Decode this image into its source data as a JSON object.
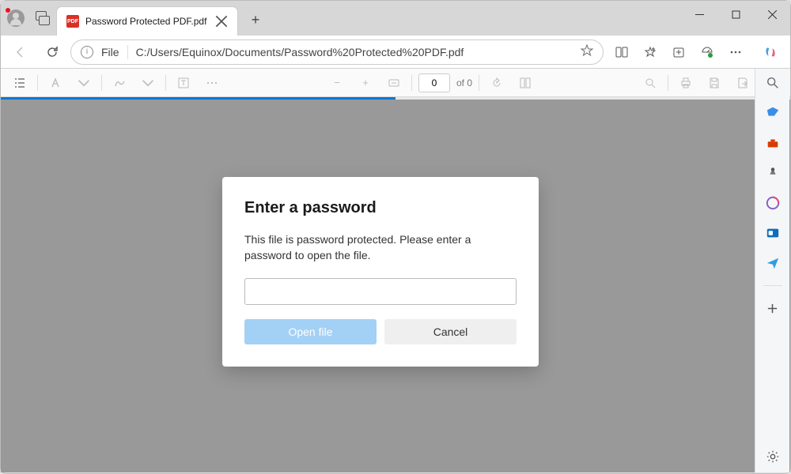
{
  "tab": {
    "title": "Password Protected PDF.pdf",
    "icon_text": "PDF"
  },
  "url": {
    "scheme": "File",
    "path": "C:/Users/Equinox/Documents/Password%20Protected%20PDF.pdf"
  },
  "pdfbar": {
    "page_current": "0",
    "page_total": "of 0"
  },
  "dialog": {
    "title": "Enter a password",
    "body": "This file is password protected. Please enter a password to open the file.",
    "open_label": "Open file",
    "cancel_label": "Cancel"
  }
}
